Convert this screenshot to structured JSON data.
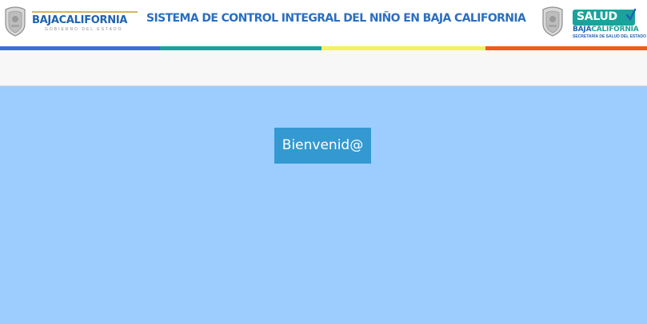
{
  "header": {
    "left_logo": {
      "word_part1": "BAJA",
      "word_part2": "CALIFORNIA",
      "subtitle": "GOBIERNO DEL ESTADO",
      "shield_icon": "state-shield-icon"
    },
    "system_title": "SISTEMA DE CONTROL INTEGRAL DEL NIÑO EN BAJA CALIFORNIA",
    "right_logo": {
      "badge": "SALUD",
      "word_part1": "BAJA",
      "word_part2": "CALIFORNIA",
      "subtitle": "SECRETARÍA DE SALUD DEL ESTADO",
      "shield_icon": "state-shield-icon"
    },
    "color_stripes": [
      "#3a6fd4",
      "#17a29b",
      "#f2f25a",
      "#f05a14"
    ]
  },
  "main": {
    "welcome_label": "Bienvenid@"
  },
  "colors": {
    "background": "#9dcdff",
    "button": "#3499d1",
    "title": "#2a6fc0"
  }
}
